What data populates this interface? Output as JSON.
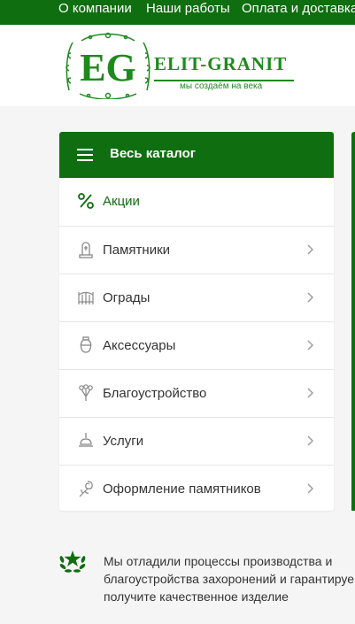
{
  "top_nav": {
    "items": [
      "О компании",
      "Наши работы",
      "Оплата и доставка"
    ]
  },
  "logo": {
    "monogram": "EG",
    "name": "ELIT-GRANIT",
    "tagline": "мы создаём на века"
  },
  "catalog": {
    "title": "Весь каталог",
    "items": [
      {
        "label": "Акции",
        "icon": "percent-icon"
      },
      {
        "label": "Памятники",
        "icon": "monument-icon"
      },
      {
        "label": "Ограды",
        "icon": "fence-icon"
      },
      {
        "label": "Аксессуары",
        "icon": "vase-icon"
      },
      {
        "label": "Благоустройство",
        "icon": "flowers-icon"
      },
      {
        "label": "Услуги",
        "icon": "bell-icon"
      },
      {
        "label": "Оформление памятников",
        "icon": "rose-icon"
      }
    ]
  },
  "info": {
    "lines": [
      "Мы отладили процессы производства и",
      "благоустройства захоронений и гарантируем,",
      "получите качественное изделие"
    ]
  },
  "colors": {
    "brand_green": "#0f6e10",
    "logo_green": "#1e8a1e",
    "background": "#f5f5f5"
  }
}
